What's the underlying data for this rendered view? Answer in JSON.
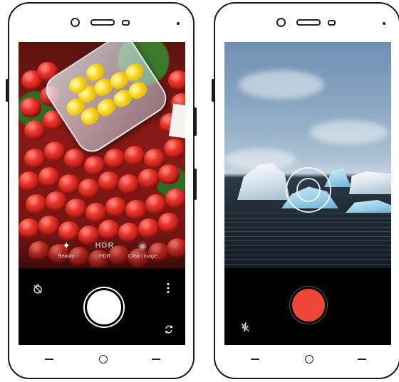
{
  "left_phone": {
    "modes": [
      {
        "id": "beauty",
        "icon": "sparkle-icon",
        "glyph": "✦",
        "label": "Beauty"
      },
      {
        "id": "hdr",
        "icon": "hdr-icon",
        "glyph": "HDR",
        "label": "HDR"
      },
      {
        "id": "clear-image",
        "icon": "clear-image-icon",
        "glyph": "◉",
        "label": "Clear image"
      }
    ],
    "controls": {
      "timer_icon": "timer-off-icon",
      "more_icon": "more-vertical-icon",
      "switch_camera_icon": "switch-camera-icon"
    }
  },
  "right_phone": {
    "controls": {
      "flash_icon": "flash-off-icon"
    }
  },
  "colors": {
    "record_button": "#f0463a",
    "shutter_button": "#ffffff",
    "control_bar": "#000000"
  }
}
